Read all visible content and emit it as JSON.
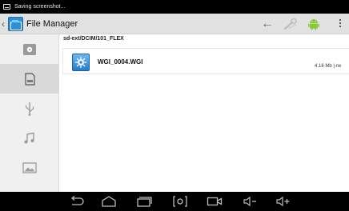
{
  "status_bar": {
    "notification_text": "Saving screenshot..."
  },
  "action_bar": {
    "title": "File Manager",
    "icons": [
      "chevron-left-icon",
      "file-manager-app-icon",
      "back-arrow-icon",
      "tools-icon",
      "android-icon",
      "overflow-menu-icon"
    ]
  },
  "sidebar": {
    "items": [
      {
        "icon": "internal-storage-icon",
        "active": false
      },
      {
        "icon": "sd-card-icon",
        "active": true
      },
      {
        "icon": "usb-icon",
        "active": false
      },
      {
        "icon": "music-icon",
        "active": false
      },
      {
        "icon": "pictures-icon",
        "active": false
      }
    ]
  },
  "main": {
    "path": "sd-ext/DCIM/101_FLEX",
    "files": [
      {
        "name": "WGI_0004.WGI",
        "size": "4.16 Mb",
        "permissions": "|-rw"
      }
    ]
  },
  "nav_bar": {
    "icons": [
      "back-icon",
      "home-icon",
      "recent-apps-icon",
      "screenshot-icon",
      "camera-icon",
      "volume-down-icon",
      "volume-up-icon"
    ]
  }
}
